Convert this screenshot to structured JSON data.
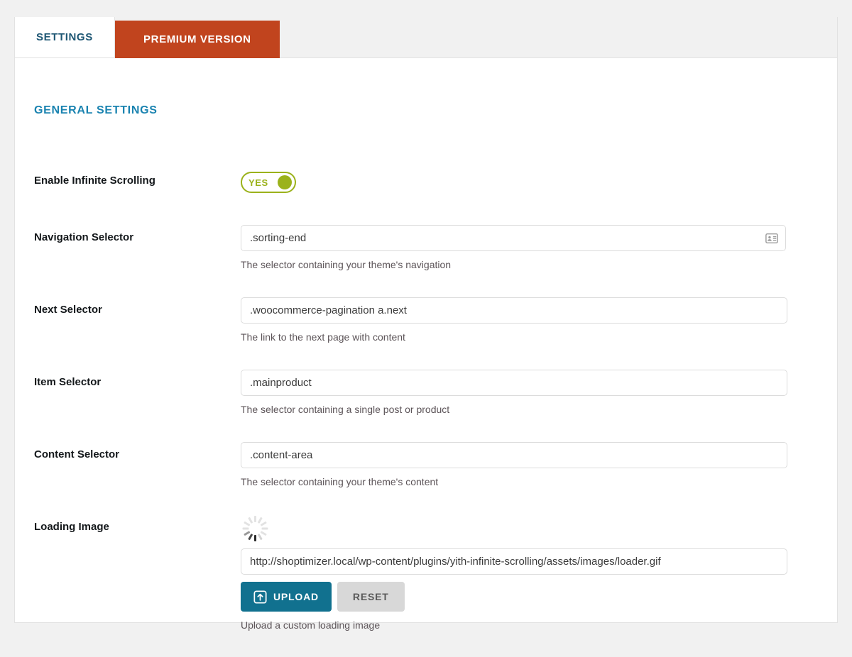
{
  "tabs": [
    {
      "label": "SETTINGS",
      "state": "active"
    },
    {
      "label": "PREMIUM VERSION",
      "state": "promo"
    }
  ],
  "section": {
    "title": "GENERAL SETTINGS"
  },
  "fields": {
    "infinite_scrolling": {
      "label": "Enable Infinite Scrolling",
      "toggle_text": "YES",
      "toggle_state": "on"
    },
    "navigation_selector": {
      "label": "Navigation Selector",
      "value": ".sorting-end",
      "placeholder": "",
      "hint": "The selector containing your theme's navigation",
      "icon": "contact-card-icon"
    },
    "next_selector": {
      "label": "Next Selector",
      "value": ".woocommerce-pagination a.next",
      "placeholder": "",
      "hint": "The link to the next page with content"
    },
    "item_selector": {
      "label": "Item Selector",
      "value": ".mainproduct",
      "placeholder": "",
      "hint": "The selector containing a single post or product"
    },
    "content_selector": {
      "label": "Content Selector",
      "value": ".content-area",
      "placeholder": "",
      "hint": "The selector containing your theme's content"
    },
    "loading_image": {
      "label": "Loading Image",
      "value": "http://shoptimizer.local/wp-content/plugins/yith-infinite-scrolling/assets/images/loader.gif",
      "placeholder": "",
      "hint": "Upload a custom loading image",
      "upload_label": "UPLOAD",
      "reset_label": "RESET",
      "preview_icon": "loading-spinner-icon"
    }
  },
  "colors": {
    "tab_active_text": "#1d5673",
    "tab_promo_bg": "#c1441e",
    "section_title": "#1a83b0",
    "toggle_on": "#9bb21b",
    "upload_button": "#11718f",
    "reset_button": "#d8d8d8",
    "page_background": "#f1f1f1"
  }
}
